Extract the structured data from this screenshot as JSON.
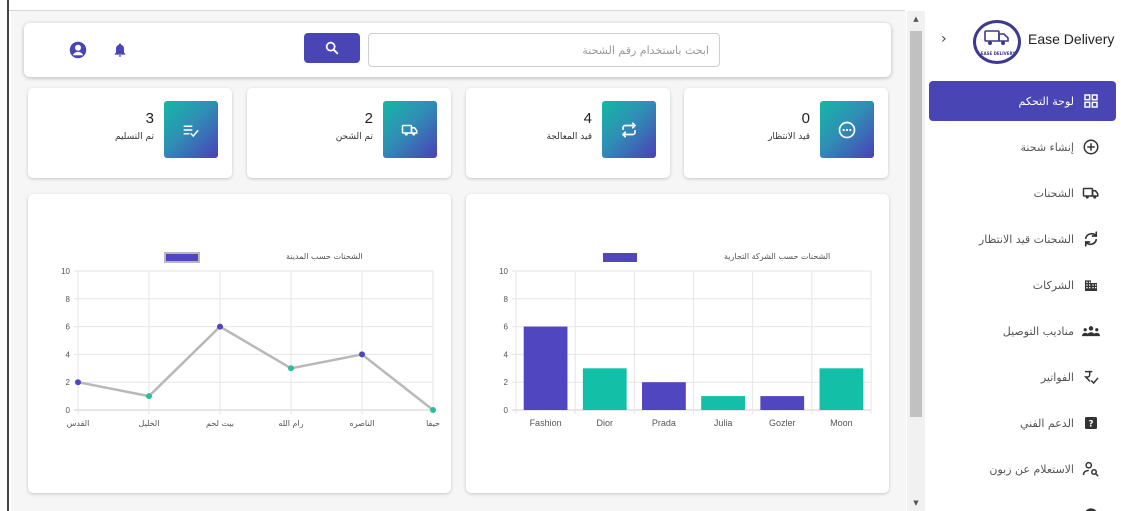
{
  "header": {
    "search_placeholder": "ابحث باستخدام رقم الشحنة",
    "icons": [
      "account-circle-icon",
      "bell-icon",
      "search-icon"
    ]
  },
  "stats": [
    {
      "value": "0",
      "label": "قيد الانتظار",
      "icon": "pending-icon"
    },
    {
      "value": "4",
      "label": "قيد المعالجة",
      "icon": "swap-arrows-icon"
    },
    {
      "value": "2",
      "label": "تم الشحن",
      "icon": "truck-icon"
    },
    {
      "value": "3",
      "label": "تم التسليم",
      "icon": "list-check-icon"
    }
  ],
  "sidebar": {
    "brand_name": "Ease Delivery",
    "logo_text": "EASE DELIVERY",
    "items": [
      {
        "label": "لوحة التحكم",
        "icon": "dashboard-grid-icon",
        "active": true
      },
      {
        "label": "إنشاء شحنة",
        "icon": "add-circle-icon"
      },
      {
        "label": "الشحنات",
        "icon": "truck-icon"
      },
      {
        "label": "الشحنات قيد الانتظار",
        "icon": "sync-icon"
      },
      {
        "label": "الشركات",
        "icon": "building-icon"
      },
      {
        "label": "مناديب التوصيل",
        "icon": "group-icon"
      },
      {
        "label": "الفواتير",
        "icon": "invoice-icon"
      },
      {
        "label": "الدعم الفني",
        "icon": "help-box-icon"
      },
      {
        "label": "الاستعلام عن زبون",
        "icon": "person-search-icon"
      }
    ]
  },
  "colors": {
    "primary": "#4a45b5",
    "teal": "#13bfa6",
    "line": "#b8b8b8",
    "point_teal": "#2bbfa0",
    "point_purple": "#5046c0"
  },
  "chart_data": [
    {
      "type": "bar",
      "legend": "الشحنات حسب الشركة التجارية",
      "categories": [
        "Moon",
        "Gozler",
        "Julia",
        "Prada",
        "Dior",
        "Fashion"
      ],
      "values": [
        3,
        1,
        1,
        2,
        3,
        6
      ],
      "colors": [
        "#13bfa6",
        "#5046c0",
        "#13bfa6",
        "#5046c0",
        "#13bfa6",
        "#5046c0"
      ],
      "ylim": [
        0,
        10
      ],
      "yticks": [
        0,
        2,
        4,
        6,
        8,
        10
      ],
      "grid": true,
      "legend_position": "top"
    },
    {
      "type": "line",
      "legend": "الشحنات حسب المدينة",
      "categories": [
        "حيفا",
        "الناصره",
        "رام الله",
        "بيت لحم",
        "الخليل",
        "القدس"
      ],
      "values": [
        0,
        4,
        3,
        6,
        1,
        2
      ],
      "point_colors": [
        "#2bbfa0",
        "#5046c0",
        "#2bbfa0",
        "#5046c0",
        "#2bbfa0",
        "#5046c0"
      ],
      "ylim": [
        0,
        10
      ],
      "yticks": [
        0,
        2,
        4,
        6,
        8,
        10
      ],
      "grid": true,
      "legend_position": "top"
    }
  ]
}
